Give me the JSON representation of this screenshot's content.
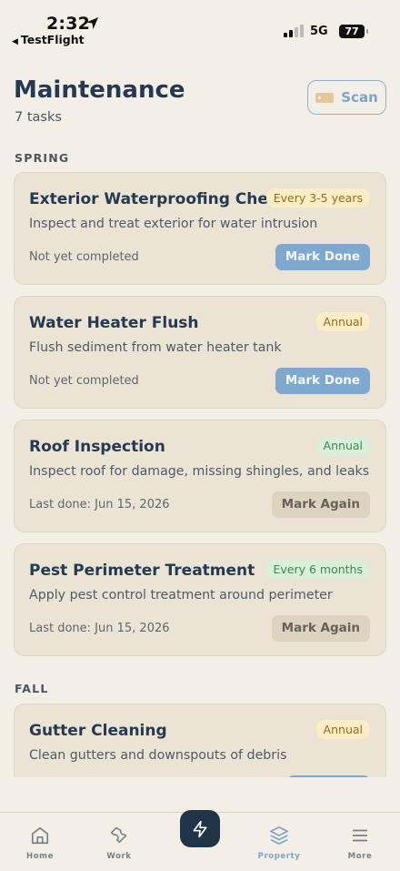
{
  "status_bar": {
    "time": "2:32",
    "back_app": "TestFlight",
    "network": "5G",
    "battery": "77"
  },
  "header": {
    "title": "Maintenance",
    "task_count": "7 tasks",
    "scan_label": "Scan"
  },
  "sections": [
    {
      "label": "SPRING",
      "tasks": [
        {
          "title": "Exterior Waterproofing Check",
          "frequency": "Every 3-5 years",
          "description": "Inspect and treat exterior for water intrusion",
          "status": "Not yet completed",
          "action": "Mark Done"
        },
        {
          "title": "Water Heater Flush",
          "frequency": "Annual",
          "description": "Flush sediment from water heater tank",
          "status": "Not yet completed",
          "action": "Mark Done"
        },
        {
          "title": "Roof Inspection",
          "frequency": "Annual",
          "description": "Inspect roof for damage, missing shingles, and leaks",
          "status": "Last done: Jun 15, 2026",
          "action": "Mark Again"
        },
        {
          "title": "Pest Perimeter Treatment",
          "frequency": "Every 6 months",
          "description": "Apply pest control treatment around perimeter",
          "status": "Last done: Jun 15, 2026",
          "action": "Mark Again"
        }
      ]
    },
    {
      "label": "FALL",
      "tasks": [
        {
          "title": "Gutter Cleaning",
          "frequency": "Annual",
          "description": "Clean gutters and downspouts of debris"
        }
      ]
    }
  ],
  "tab_bar": {
    "tabs": [
      {
        "label": "Home",
        "icon": "home-icon"
      },
      {
        "label": "Work",
        "icon": "wrench-icon"
      },
      {
        "label": "Property",
        "icon": "layers-icon",
        "active": true
      },
      {
        "label": "More",
        "icon": "menu-icon"
      }
    ],
    "center_action_icon": "lightning-icon"
  },
  "colors": {
    "background": "#f3efe6",
    "card": "#ebe4d5",
    "accent": "#7ea8cd",
    "title": "#243a52",
    "badge_yellow": "#fbeec7",
    "badge_green": "#d9efd9"
  }
}
